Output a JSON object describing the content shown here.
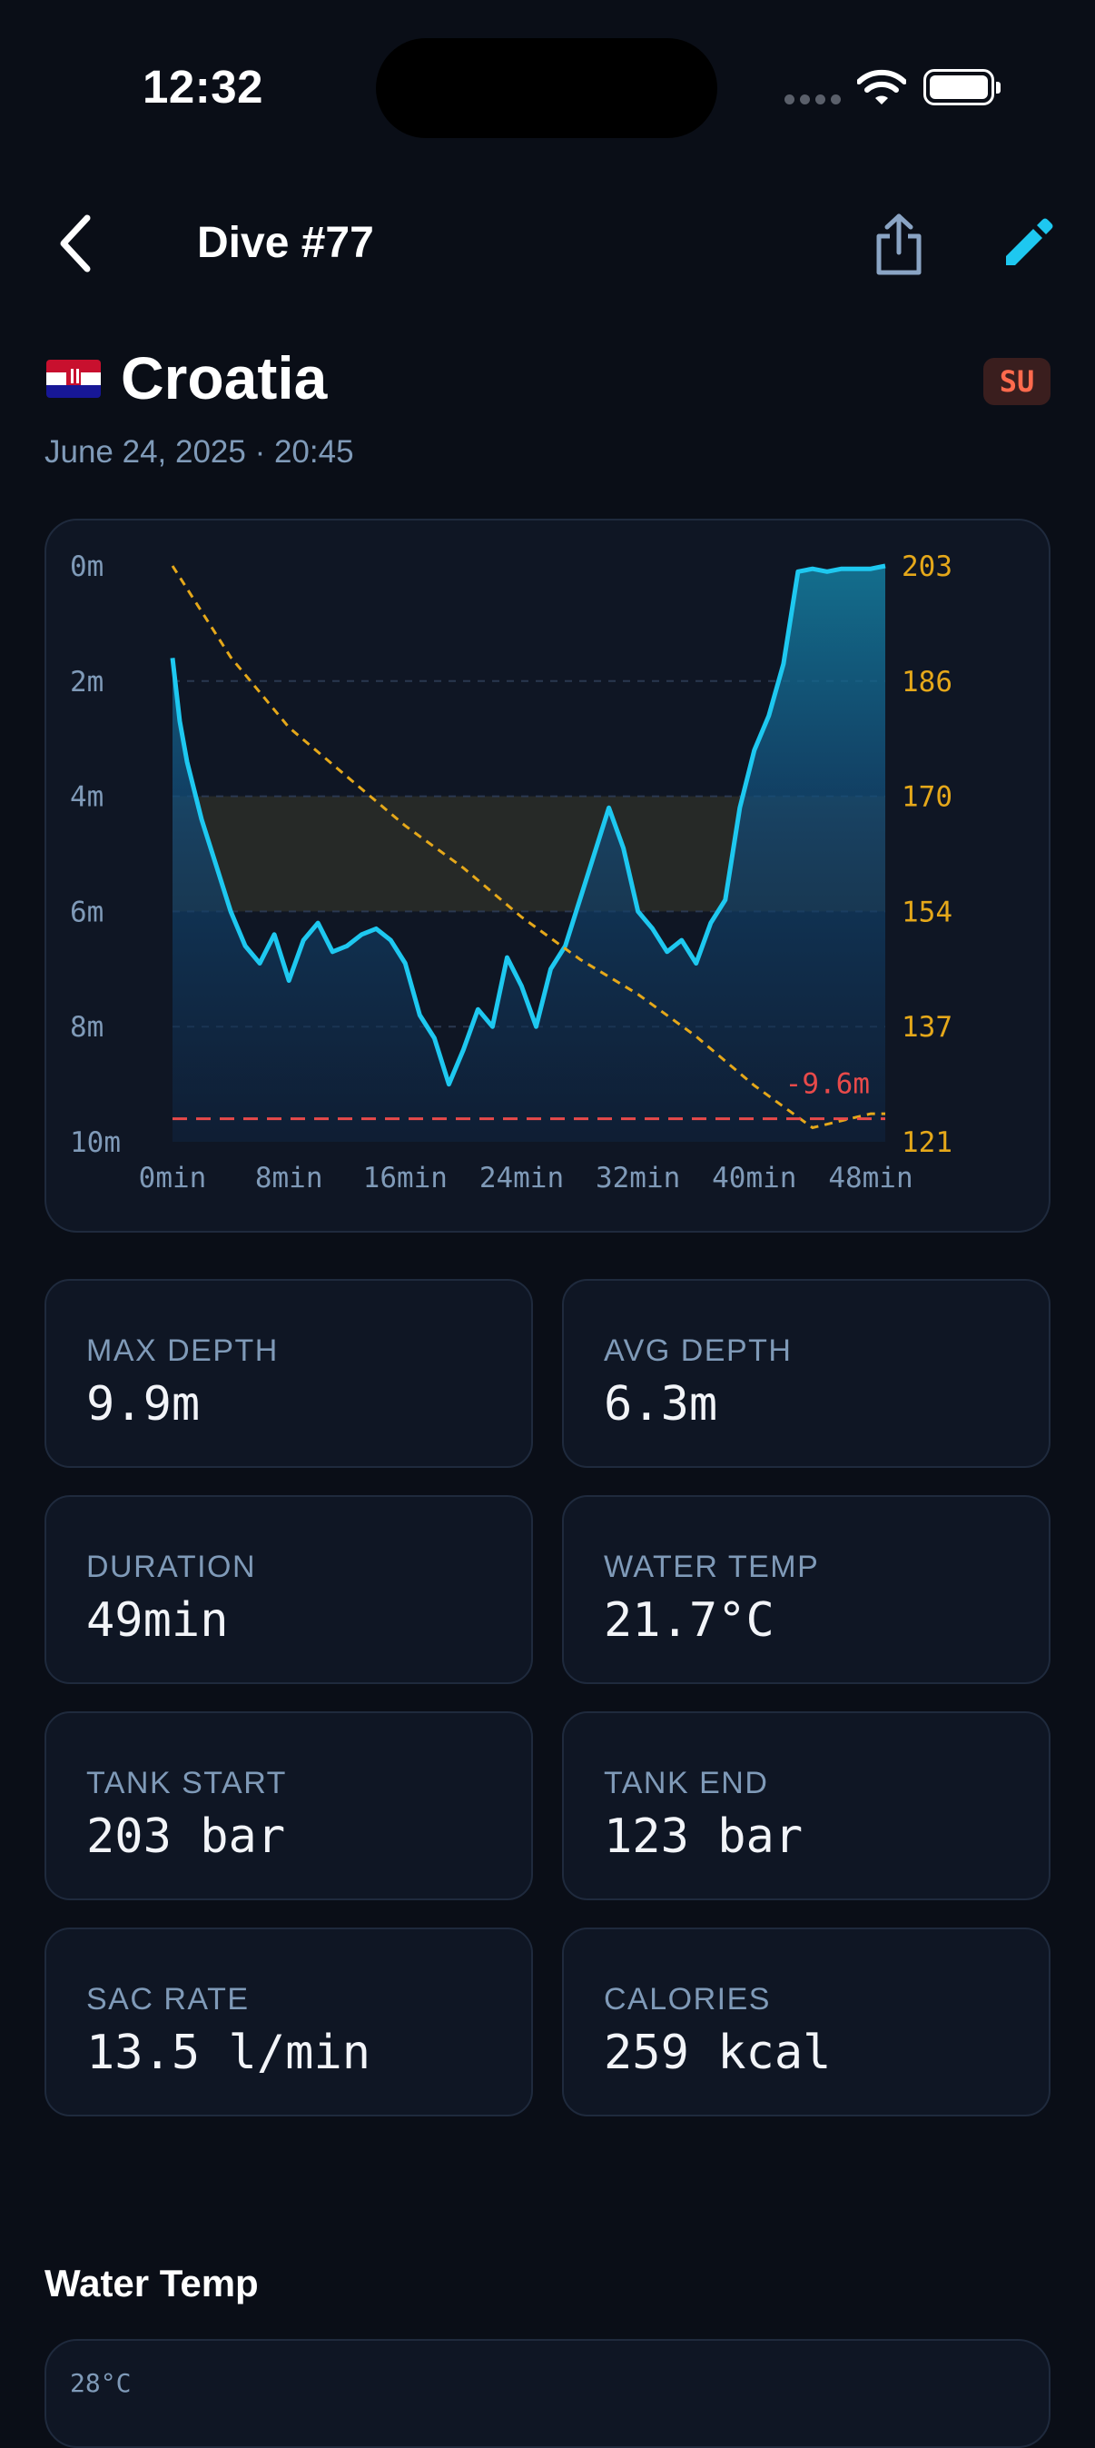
{
  "status_bar": {
    "time": "12:32"
  },
  "nav": {
    "title": "Dive #77"
  },
  "header": {
    "country": "Croatia",
    "badge": "SU",
    "datetime": "June 24, 2025 · 20:45"
  },
  "colors": {
    "background": "#0a0e17",
    "card": "#0f1624",
    "accent": "#1ec8f0",
    "pressure": "#e5a81a",
    "max_depth_line": "#e84a4a",
    "badge": "#ff6a4d"
  },
  "icons": [
    "chevron-left-icon",
    "share-icon",
    "pencil-icon",
    "croatia-flag-icon",
    "wifi-icon",
    "battery-icon"
  ],
  "chart_data": {
    "type": "line",
    "y_axis_left": {
      "ylim": [
        0,
        10
      ],
      "ticks": [
        "0m",
        "2m",
        "4m",
        "6m",
        "8m",
        "10m"
      ],
      "inverted": true
    },
    "y_axis_right": {
      "ylim": [
        121,
        203
      ],
      "ticks": [
        "203",
        "186",
        "170",
        "154",
        "137",
        "121"
      ]
    },
    "x_axis": {
      "xlim": [
        0,
        49
      ],
      "ticks": [
        "0min",
        "8min",
        "16min",
        "24min",
        "32min",
        "40min",
        "48min"
      ]
    },
    "depth_band": [
      4,
      6
    ],
    "max_depth_label": "-9.6m",
    "max_depth_value": 9.6,
    "series": [
      {
        "x": [
          0,
          0.5,
          1,
          2,
          3,
          4,
          5,
          6,
          7,
          8,
          9,
          10,
          11,
          12,
          13,
          14,
          15,
          16,
          17,
          18,
          19,
          20,
          21,
          22,
          23,
          24,
          25,
          26,
          27,
          28,
          29,
          30,
          31,
          32,
          33,
          34,
          35,
          36,
          37,
          38,
          39,
          40,
          41,
          42,
          43,
          44,
          45,
          46,
          47,
          48,
          49
        ],
        "y": [
          1.6,
          2.7,
          3.4,
          4.4,
          5.2,
          6.0,
          6.6,
          6.9,
          6.4,
          7.2,
          6.5,
          6.2,
          6.7,
          6.6,
          6.4,
          6.3,
          6.5,
          6.9,
          7.8,
          8.2,
          9.0,
          8.4,
          7.7,
          8.0,
          6.8,
          7.3,
          8.0,
          7.0,
          6.6,
          5.8,
          5.0,
          4.2,
          4.9,
          6.0,
          6.3,
          6.7,
          6.5,
          6.9,
          6.2,
          5.8,
          4.2,
          3.2,
          2.6,
          1.7,
          0.1,
          0.05,
          0.1,
          0.05,
          0.05,
          0.05,
          0.0
        ]
      },
      {
        "x": [
          0,
          4,
          8,
          12,
          16,
          20,
          24,
          28,
          32,
          36,
          40,
          42,
          44,
          46,
          48,
          49
        ],
        "y": [
          203,
          190,
          180,
          173,
          166,
          160,
          153,
          147,
          142,
          136,
          129,
          126,
          123,
          124,
          125,
          125
        ]
      }
    ]
  },
  "stats": [
    {
      "label": "MAX DEPTH",
      "value": "9.9m"
    },
    {
      "label": "AVG DEPTH",
      "value": "6.3m"
    },
    {
      "label": "DURATION",
      "value": "49min"
    },
    {
      "label": "WATER TEMP",
      "value": "21.7°C"
    },
    {
      "label": "TANK START",
      "value": "203 bar"
    },
    {
      "label": "TANK END",
      "value": "123 bar"
    },
    {
      "label": "SAC RATE",
      "value": "13.5 l/min"
    },
    {
      "label": "CALORIES",
      "value": "259 kcal"
    }
  ],
  "water_temp": {
    "title": "Water Temp",
    "top_tick": "28°C"
  }
}
